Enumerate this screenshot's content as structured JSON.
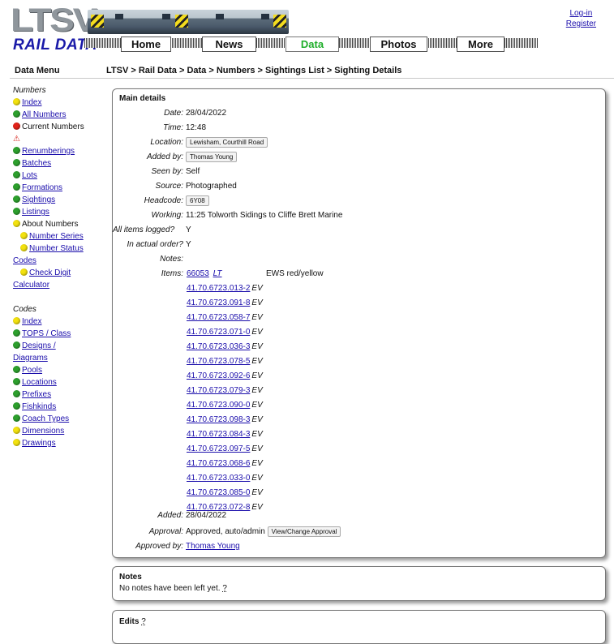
{
  "header": {
    "logo_top": "LTSV",
    "logo_bottom": "RAIL DATA",
    "nav": [
      "Home",
      "News",
      "Data",
      "Photos",
      "More"
    ],
    "login": "Log-in",
    "register": "Register"
  },
  "sidebar": {
    "title": "Data Menu",
    "numbers_heading": "Numbers",
    "numbers": [
      {
        "dot": "y",
        "label": "Index",
        "link": true
      },
      {
        "dot": "g",
        "label": "All Numbers",
        "link": true
      },
      {
        "dot": "r",
        "label": "Current Numbers",
        "link": false
      },
      {
        "dot": "warn",
        "label": "",
        "link": false
      },
      {
        "dot": "g",
        "label": "Renumberings",
        "link": true
      },
      {
        "dot": "g",
        "label": "Batches",
        "link": true
      },
      {
        "dot": "g",
        "label": "Lots",
        "link": true
      },
      {
        "dot": "g",
        "label": "Formations",
        "link": true
      },
      {
        "dot": "g",
        "label": "Sightings",
        "link": true
      },
      {
        "dot": "g",
        "label": "Listings",
        "link": true
      },
      {
        "dot": "y",
        "label": "About Numbers",
        "link": false
      },
      {
        "dot": "y",
        "label": "Number Series",
        "link": true,
        "indent": true
      },
      {
        "dot": "y",
        "label": "Number Status",
        "link": true,
        "indent": true
      },
      {
        "dot": "",
        "label": "Codes",
        "link": true
      },
      {
        "dot": "y",
        "label": "Check Digit",
        "link": true,
        "indent": true
      },
      {
        "dot": "",
        "label": "Calculator",
        "link": true
      }
    ],
    "codes_heading": "Codes",
    "codes": [
      {
        "dot": "y",
        "label": "Index"
      },
      {
        "dot": "g",
        "label": "TOPS / Class"
      },
      {
        "dot": "g",
        "label": "Designs /"
      },
      {
        "dot": "",
        "label": "Diagrams"
      },
      {
        "dot": "g",
        "label": "Pools"
      },
      {
        "dot": "g",
        "label": "Locations"
      },
      {
        "dot": "g",
        "label": "Prefixes"
      },
      {
        "dot": "g",
        "label": "Fishkinds"
      },
      {
        "dot": "g",
        "label": "Coach Types"
      },
      {
        "dot": "y",
        "label": "Dimensions"
      },
      {
        "dot": "y",
        "label": "Drawings"
      }
    ]
  },
  "breadcrumb": "LTSV > Rail Data > Data > Numbers > Sightings List > Sighting Details",
  "main": {
    "title": "Main details",
    "date_label": "Date:",
    "date": "28/04/2022",
    "time_label": "Time:",
    "time": "12:48",
    "location_label": "Location:",
    "location": "Lewisham, Courthill Road",
    "addedby_label": "Added by:",
    "addedby": "Thomas Young",
    "seenby_label": "Seen by:",
    "seenby": "Self",
    "source_label": "Source:",
    "source": "Photographed",
    "headcode_label": "Headcode:",
    "headcode": "6Y08",
    "working_label": "Working:",
    "working": "11:25 Tolworth Sidings to Cliffe Brett Marine",
    "alllogged_label": "All items logged?",
    "alllogged": "Y",
    "order_label": "In actual order?",
    "order": "Y",
    "notes_label": "Notes:",
    "items_label": "Items:",
    "first_item": {
      "num": "66053",
      "code": "LT",
      "livery": "EWS red/yellow"
    },
    "items": [
      {
        "num": "41.70.6723.013-2",
        "code": "EV"
      },
      {
        "num": "41.70.6723.091-8",
        "code": "EV"
      },
      {
        "num": "41.70.6723.058-7",
        "code": "EV"
      },
      {
        "num": "41.70.6723.071-0",
        "code": "EV"
      },
      {
        "num": "41.70.6723.036-3",
        "code": "EV"
      },
      {
        "num": "41.70.6723.078-5",
        "code": "EV"
      },
      {
        "num": "41.70.6723.092-6",
        "code": "EV"
      },
      {
        "num": "41.70.6723.079-3",
        "code": "EV"
      },
      {
        "num": "41.70.6723.090-0",
        "code": "EV"
      },
      {
        "num": "41.70.6723.098-3",
        "code": "EV"
      },
      {
        "num": "41.70.6723.084-3",
        "code": "EV"
      },
      {
        "num": "41.70.6723.097-5",
        "code": "EV"
      },
      {
        "num": "41.70.6723.068-6",
        "code": "EV"
      },
      {
        "num": "41.70.6723.033-0",
        "code": "EV"
      },
      {
        "num": "41.70.6723.085-0",
        "code": "EV"
      },
      {
        "num": "41.70.6723.072-8",
        "code": "EV"
      }
    ],
    "added_label": "Added:",
    "added": "28/04/2022",
    "approval_label": "Approval:",
    "approval": "Approved, auto/admin",
    "approval_button": "View/Change Approval",
    "approvedby_label": "Approved by:",
    "approvedby": "Thomas Young"
  },
  "notes_box": {
    "title": "Notes",
    "text": "No notes have been left yet.",
    "help": "?"
  },
  "edits_box": {
    "title": "Edits",
    "help": "?"
  },
  "colors": {
    "link": "#1a0dab",
    "nav_active": "#1fae2a",
    "logo_blue": "#1a1aa8"
  }
}
